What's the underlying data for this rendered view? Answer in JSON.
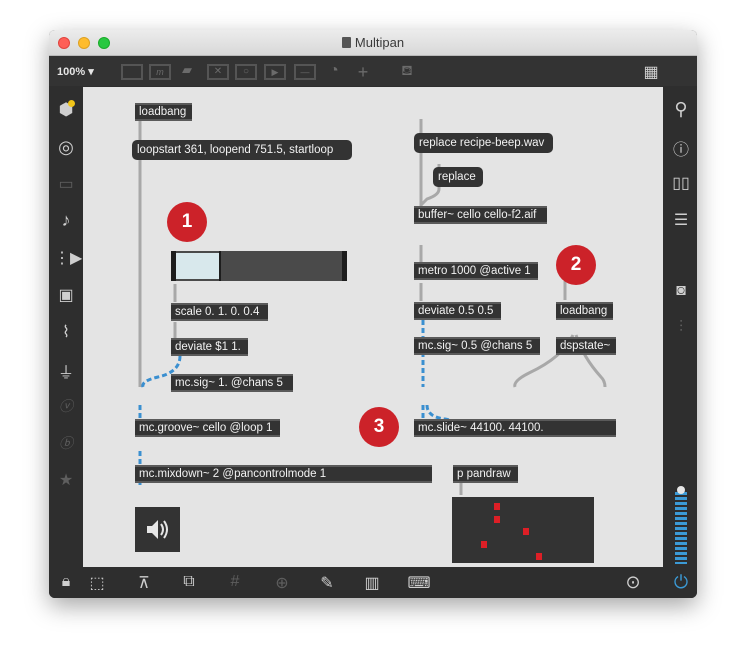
{
  "window": {
    "title": "Multipan",
    "zoom": "100%"
  },
  "colors": {
    "badge": "#cc2229",
    "canvas": "#e4e4e4",
    "object": "#333333",
    "signal_cord": "#3a8fd0",
    "meter": "#3b9ad6"
  },
  "toolbar": {
    "icons": [
      "presentation-frame-icon",
      "comment-icon",
      "speech-bubble-icon",
      "x-box-icon",
      "circle-button-icon",
      "play-box-icon",
      "slider-icon",
      "dial-icon",
      "plus-icon",
      "paint-bucket-icon",
      "grid-view-icon"
    ]
  },
  "left_sidebar": {
    "icons": [
      "packages-icon",
      "target-icon",
      "video-icon",
      "music-note-icon",
      "clip-icon",
      "image-icon",
      "paperclip-icon",
      "plug-icon",
      "v-icon",
      "b-icon",
      "star-icon"
    ]
  },
  "right_sidebar": {
    "icons": [
      "search-icon",
      "info-icon",
      "book-icon",
      "list-icon",
      "camera-icon",
      "mixer-icon",
      "volume-slider-icon",
      "power-icon"
    ]
  },
  "bottom_bar": {
    "icons": [
      "lock-icon",
      "edit-icon",
      "presentation-icon",
      "windows-icon",
      "grid-icon",
      "add-object-icon",
      "wrench-icon",
      "piano-icon",
      "keyboard-icon",
      "playback-icon"
    ]
  },
  "badges": [
    "1",
    "2",
    "3"
  ],
  "objects": {
    "loadbang1": "loadbang",
    "loop_msg": "loopstart 361, loopend 751.5, startloop",
    "scale": "scale 0. 1. 0. 0.4",
    "deviate1": "deviate $1 1.",
    "mcsig1": "mc.sig~ 1. @chans 5",
    "groove": "mc.groove~ cello @loop 1",
    "mixdown": "mc.mixdown~ 2 @pancontrolmode 1",
    "replace_file": "replace recipe-beep.wav",
    "replace": "replace",
    "buffer": "buffer~ cello cello-f2.aif",
    "metro": "metro 1000 @active 1",
    "deviate2": "deviate 0.5 0.5",
    "mcsig2": "mc.sig~ 0.5 @chans 5",
    "loadbang2": "loadbang",
    "dspstate": "dspstate~",
    "slide": "mc.slide~ 44100. 44100.",
    "pandraw": "p pandraw"
  },
  "slider": {
    "value": 0.3
  }
}
